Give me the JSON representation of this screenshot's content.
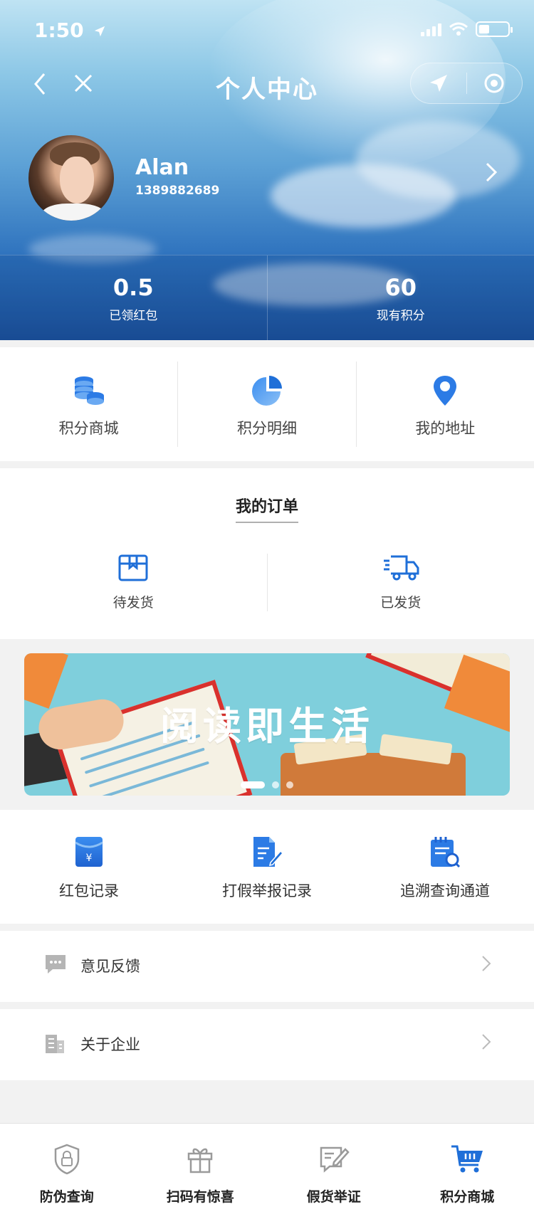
{
  "status": {
    "time": "1:50"
  },
  "nav": {
    "title": "个人中心"
  },
  "profile": {
    "name": "Alan",
    "phone": "1389882689"
  },
  "stats": [
    {
      "value": "0.5",
      "label": "已领红包"
    },
    {
      "value": "60",
      "label": "现有积分"
    }
  ],
  "quick": [
    {
      "label": "积分商城",
      "icon": "coins-stack-icon"
    },
    {
      "label": "积分明细",
      "icon": "pie-chart-icon"
    },
    {
      "label": "我的地址",
      "icon": "location-pin-icon"
    }
  ],
  "orders": {
    "title": "我的订单",
    "items": [
      {
        "label": "待发货",
        "icon": "package-icon"
      },
      {
        "label": "已发货",
        "icon": "delivery-truck-icon"
      }
    ]
  },
  "banner": {
    "text": "阅读即生活",
    "slides": 3,
    "active_slide": 1
  },
  "tools": [
    {
      "label": "红包记录",
      "icon": "red-envelope-icon"
    },
    {
      "label": "打假举报记录",
      "icon": "document-edit-icon"
    },
    {
      "label": "追溯查询通道",
      "icon": "notepad-search-icon"
    }
  ],
  "list": [
    {
      "label": "意见反馈",
      "icon": "chat-bubble-icon"
    },
    {
      "label": "关于企业",
      "icon": "building-icon"
    }
  ],
  "tabbar": [
    {
      "label": "防伪查询",
      "icon": "shield-lock-icon"
    },
    {
      "label": "扫码有惊喜",
      "icon": "gift-icon"
    },
    {
      "label": "假货举证",
      "icon": "report-edit-icon"
    },
    {
      "label": "积分商城",
      "icon": "shopping-cart-icon",
      "active": true
    }
  ],
  "colors": {
    "accent": "#1f6fd8",
    "icon_gray": "#a9a9a9"
  }
}
